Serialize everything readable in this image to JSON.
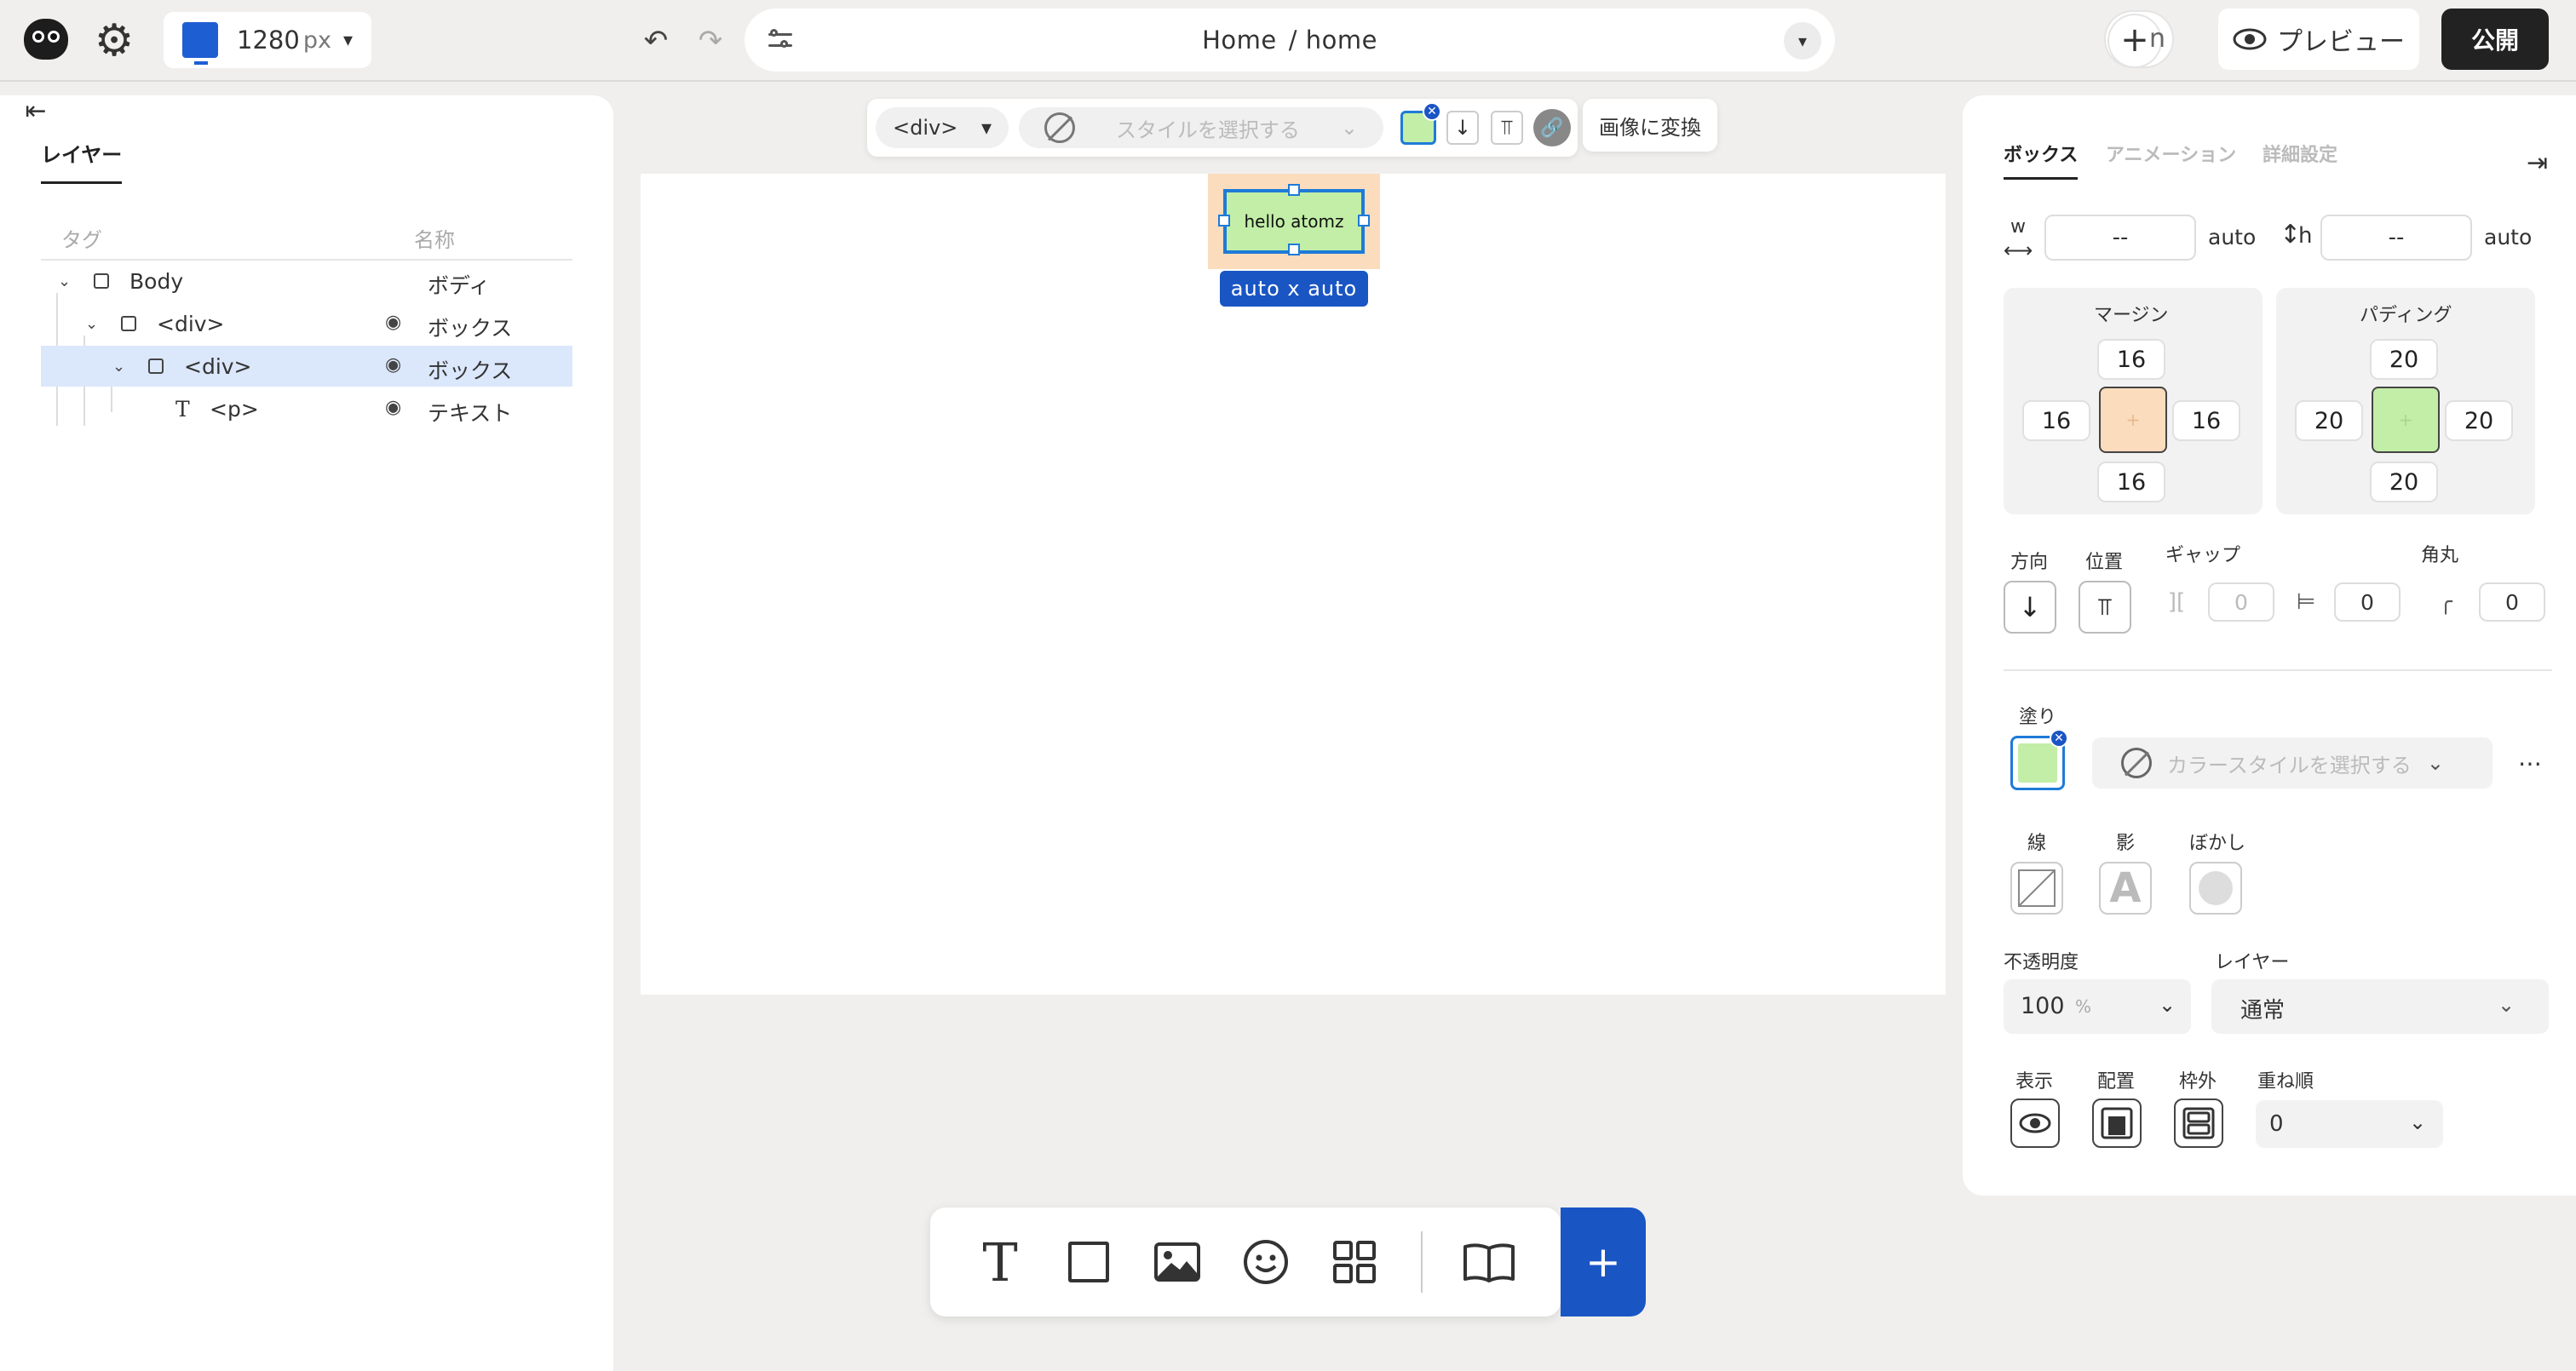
{
  "app": {
    "viewport_width": "1280",
    "viewport_unit": "px",
    "url_page": "Home",
    "url_path": "/ home",
    "user_initial": "n",
    "preview_label": "プレビュー",
    "publish_label": "公開"
  },
  "layers": {
    "tab_label": "レイヤー",
    "col_tag": "タグ",
    "col_name": "名称",
    "rows": [
      {
        "tag": "Body",
        "name": "ボディ"
      },
      {
        "tag": "<div>",
        "name": "ボックス"
      },
      {
        "tag": "<div>",
        "name": "ボックス",
        "selected": true
      },
      {
        "tag": "<p>",
        "name": "テキスト"
      }
    ]
  },
  "canvas": {
    "element_text": "hello atomz",
    "size_label": "auto x auto"
  },
  "element_toolbar": {
    "tag": "<div>",
    "style_placeholder": "スタイルを選択する",
    "convert_label": "画像に変換",
    "fill_color": "#c2eea7"
  },
  "bottom_toolbar": {
    "items": [
      "text-tool",
      "box-tool",
      "image-tool",
      "emoji-tool",
      "components-tool",
      "library-tool",
      "add-tool"
    ]
  },
  "properties": {
    "tabs": [
      "ボックス",
      "アニメーション",
      "詳細設定"
    ],
    "width_label": "w",
    "width_value": "--",
    "width_mode": "auto",
    "height_label": "h",
    "height_value": "--",
    "height_mode": "auto",
    "margin_label": "マージン",
    "margin": {
      "top": "16",
      "left": "16",
      "right": "16",
      "bottom": "16"
    },
    "padding_label": "パディング",
    "padding": {
      "top": "20",
      "left": "20",
      "right": "20",
      "bottom": "20"
    },
    "direction_label": "方向",
    "position_label": "位置",
    "gap_label": "ギャップ",
    "gap_col": "0",
    "gap_row": "0",
    "radius_label": "角丸",
    "radius": "0",
    "fill_label": "塗り",
    "fill_color": "#c2eea7",
    "color_style_placeholder": "カラースタイルを選択する",
    "stroke_label": "線",
    "shadow_label": "影",
    "blur_label": "ぼかし",
    "opacity_label": "不透明度",
    "opacity_value": "100",
    "opacity_unit": "%",
    "layer_label": "レイヤー",
    "layer_value": "通常",
    "visibility_label": "表示",
    "placement_label": "配置",
    "overflow_label": "枠外",
    "zindex_label": "重ね順",
    "zindex_value": "0"
  },
  "colors": {
    "accent": "#1a55c4",
    "margin_color": "#fbdcbd",
    "padding_color": "#c2eea7"
  }
}
